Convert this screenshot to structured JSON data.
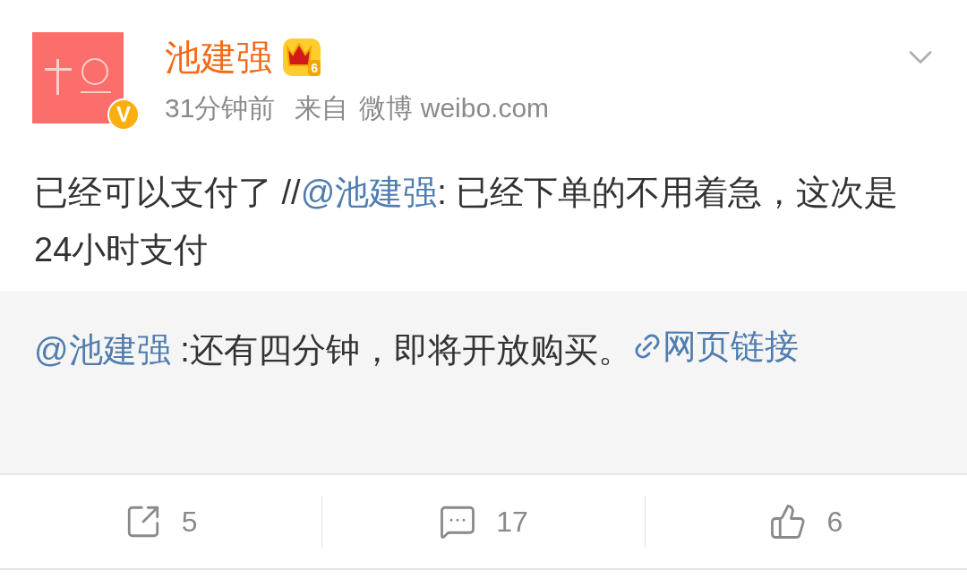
{
  "post": {
    "author": "池建强",
    "vip_level": "6",
    "verified_badge": "V",
    "time": "31分钟前",
    "source_prefix": "来自",
    "source": "微博 weibo.com",
    "content": [
      {
        "kind": "text",
        "text": "已经可以支付了 //"
      },
      {
        "kind": "mention",
        "text": "@池建强"
      },
      {
        "kind": "text",
        "text": ": 已经下单的不用着急，这次是24小时支付"
      }
    ]
  },
  "quoted": {
    "content": [
      {
        "kind": "mention",
        "text": "@池建强"
      },
      {
        "kind": "text",
        "text": " :还有四分钟，即将开放购买。"
      },
      {
        "kind": "link",
        "text": "网页链接"
      }
    ]
  },
  "actions": [
    {
      "kind": "repost",
      "count": "5"
    },
    {
      "kind": "comment",
      "count": "17"
    },
    {
      "kind": "like",
      "count": "6"
    }
  ]
}
